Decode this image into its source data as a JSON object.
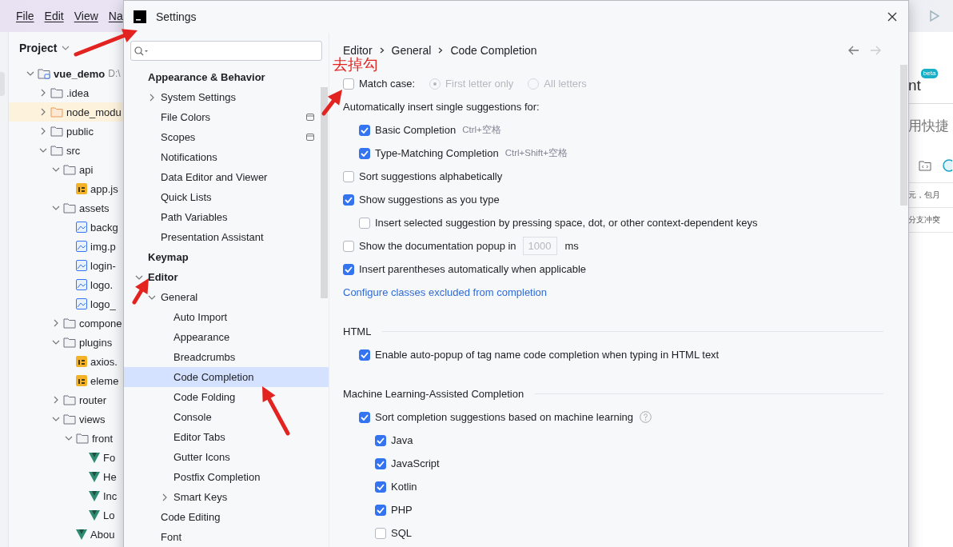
{
  "menu": [
    "File",
    "Edit",
    "View",
    "Na"
  ],
  "project": {
    "title": "Project",
    "tree": [
      {
        "label": "vue_demo",
        "path": "D:\\",
        "kind": "project",
        "expanded": true,
        "children": [
          {
            "label": ".idea",
            "kind": "folder",
            "expanded": false
          },
          {
            "label": "node_modu",
            "kind": "folder",
            "excluded": true,
            "expanded": false
          },
          {
            "label": "public",
            "kind": "folder",
            "expanded": false
          },
          {
            "label": "src",
            "kind": "folder",
            "expanded": true,
            "children": [
              {
                "label": "api",
                "kind": "folder",
                "expanded": true,
                "children": [
                  {
                    "label": "app.js",
                    "kind": "js"
                  }
                ]
              },
              {
                "label": "assets",
                "kind": "folder",
                "expanded": true,
                "children": [
                  {
                    "label": "backg",
                    "kind": "image"
                  },
                  {
                    "label": "img.p",
                    "kind": "image"
                  },
                  {
                    "label": "login-",
                    "kind": "image"
                  },
                  {
                    "label": "logo.",
                    "kind": "image"
                  },
                  {
                    "label": "logo_",
                    "kind": "image"
                  }
                ]
              },
              {
                "label": "compone",
                "kind": "folder",
                "expanded": false
              },
              {
                "label": "plugins",
                "kind": "folder",
                "expanded": true,
                "children": [
                  {
                    "label": "axios.",
                    "kind": "js"
                  },
                  {
                    "label": "eleme",
                    "kind": "js"
                  }
                ]
              },
              {
                "label": "router",
                "kind": "folder",
                "expanded": false
              },
              {
                "label": "views",
                "kind": "folder",
                "expanded": true,
                "children": [
                  {
                    "label": "front",
                    "kind": "folder",
                    "expanded": true,
                    "children": [
                      {
                        "label": "Fo",
                        "kind": "vue"
                      },
                      {
                        "label": "He",
                        "kind": "vue"
                      },
                      {
                        "label": "Inc",
                        "kind": "vue"
                      },
                      {
                        "label": "Lo",
                        "kind": "vue"
                      }
                    ]
                  },
                  {
                    "label": "Abou",
                    "kind": "vue"
                  }
                ]
              }
            ]
          }
        ]
      }
    ]
  },
  "right_panel": {
    "title": "nt",
    "badge": "beta",
    "lines": [
      "用快捷",
      "元，包月",
      "分支冲突"
    ]
  },
  "dialog": {
    "title": "Settings",
    "sidebar": [
      {
        "label": "Appearance & Behavior",
        "selected": false,
        "children": [
          {
            "label": "System Settings",
            "selected": false,
            "expanded": false
          },
          {
            "label": "File Colors",
            "selected": false,
            "project_level": true
          },
          {
            "label": "Scopes",
            "selected": false,
            "project_level": true
          },
          {
            "label": "Notifications",
            "selected": false
          },
          {
            "label": "Data Editor and Viewer",
            "selected": false
          },
          {
            "label": "Quick Lists",
            "selected": false
          },
          {
            "label": "Path Variables",
            "selected": false
          },
          {
            "label": "Presentation Assistant",
            "selected": false
          }
        ]
      },
      {
        "label": "Keymap",
        "selected": false
      },
      {
        "label": "Editor",
        "selected": false,
        "expanded": true,
        "children": [
          {
            "label": "General",
            "selected": false,
            "expanded": true,
            "children": [
              {
                "label": "Auto Import",
                "selected": false
              },
              {
                "label": "Appearance",
                "selected": false
              },
              {
                "label": "Breadcrumbs",
                "selected": false
              },
              {
                "label": "Code Completion",
                "selected": true
              },
              {
                "label": "Code Folding",
                "selected": false
              },
              {
                "label": "Console",
                "selected": false
              },
              {
                "label": "Editor Tabs",
                "selected": false
              },
              {
                "label": "Gutter Icons",
                "selected": false
              },
              {
                "label": "Postfix Completion",
                "selected": false
              },
              {
                "label": "Smart Keys",
                "selected": false,
                "expanded": false
              }
            ]
          },
          {
            "label": "Code Editing",
            "selected": false
          },
          {
            "label": "Font",
            "selected": false
          }
        ]
      }
    ],
    "breadcrumb": [
      "Editor",
      "General",
      "Code Completion"
    ],
    "options": [
      {
        "kind": "checkbox",
        "label": "Match case:",
        "checked": false,
        "radios": [
          {
            "label": "First letter only",
            "selected": true,
            "disabled": true
          },
          {
            "label": "All letters",
            "selected": false,
            "disabled": true
          }
        ]
      },
      {
        "kind": "label",
        "label": "Automatically insert single suggestions for:",
        "children": [
          {
            "kind": "checkbox",
            "label": "Basic Completion",
            "hint": "Ctrl+空格",
            "checked": true
          },
          {
            "kind": "checkbox",
            "label": "Type-Matching Completion",
            "hint": "Ctrl+Shift+空格",
            "checked": true
          }
        ]
      },
      {
        "kind": "checkbox",
        "label": "Sort suggestions alphabetically",
        "checked": false
      },
      {
        "kind": "checkbox",
        "label": "Show suggestions as you type",
        "checked": true,
        "children": [
          {
            "kind": "checkbox",
            "label": "Insert selected suggestion by pressing space, dot, or other context-dependent keys",
            "checked": false
          }
        ]
      },
      {
        "kind": "checkbox",
        "label": "Show the documentation popup in",
        "checked": false,
        "field": {
          "value": "1000",
          "disabled": true
        },
        "suffix": "ms"
      },
      {
        "kind": "checkbox",
        "label": "Insert parentheses automatically when applicable",
        "checked": true
      },
      {
        "kind": "link",
        "label": "Configure classes excluded from completion"
      },
      {
        "kind": "section",
        "label": "HTML",
        "children": [
          {
            "kind": "checkbox",
            "label": "Enable auto-popup of tag name code completion when typing in HTML text",
            "checked": true
          }
        ]
      },
      {
        "kind": "section",
        "label": "Machine Learning-Assisted Completion",
        "children": [
          {
            "kind": "checkbox",
            "label": "Sort completion suggestions based on machine learning",
            "checked": true,
            "help": true,
            "children": [
              {
                "kind": "checkbox",
                "label": "Java",
                "checked": true
              },
              {
                "kind": "checkbox",
                "label": "JavaScript",
                "checked": true
              },
              {
                "kind": "checkbox",
                "label": "Kotlin",
                "checked": true
              },
              {
                "kind": "checkbox",
                "label": "PHP",
                "checked": true
              },
              {
                "kind": "checkbox",
                "label": "SQL",
                "checked": false
              }
            ]
          }
        ]
      }
    ]
  },
  "annotation": "去掉勾"
}
